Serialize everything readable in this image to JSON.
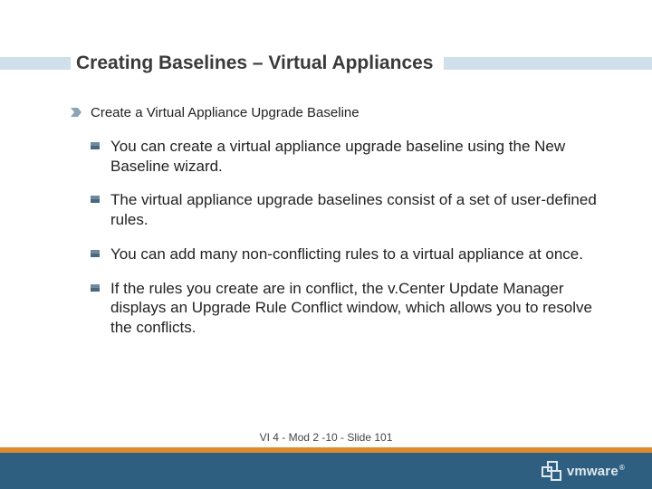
{
  "title": "Creating Baselines – Virtual Appliances",
  "section_heading": "Create a Virtual Appliance Upgrade Baseline",
  "bullets": [
    "You can create a virtual appliance upgrade baseline using the New Baseline wizard.",
    "The virtual appliance upgrade baselines consist of a set of user-defined rules.",
    "You can add many non-conflicting rules to a virtual appliance at once.",
    "If the rules you create are in conflict, the v.Center Update Manager displays an Upgrade Rule Conflict window, which allows you to resolve the conflicts."
  ],
  "footer": "VI 4 - Mod 2 -10 - Slide 101",
  "logo": {
    "text": "vmware",
    "reg": "®"
  }
}
